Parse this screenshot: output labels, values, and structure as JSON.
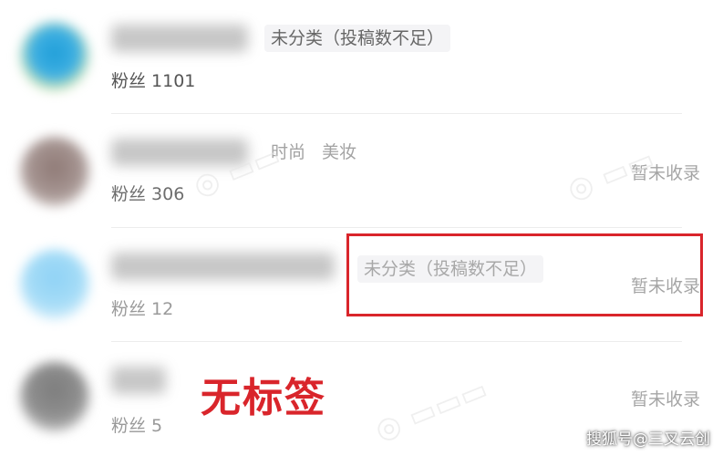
{
  "rows": [
    {
      "tags": [
        "未分类（投稿数不足）"
      ],
      "fans": "粉丝 1101",
      "status": ""
    },
    {
      "tags": [
        "时尚",
        "美妆"
      ],
      "fans": "粉丝 306",
      "status": "暂未收录"
    },
    {
      "tags": [
        "未分类（投稿数不足）"
      ],
      "fans": "粉丝 12",
      "status": "暂未收录"
    },
    {
      "tags": [],
      "fans": "粉丝 5",
      "status": "暂未收录"
    }
  ],
  "annotation": "无标签",
  "credit": "搜狐号@三叉云创",
  "colors": {
    "highlight": "#d9252b",
    "muted_text": "#a5a5a5"
  }
}
